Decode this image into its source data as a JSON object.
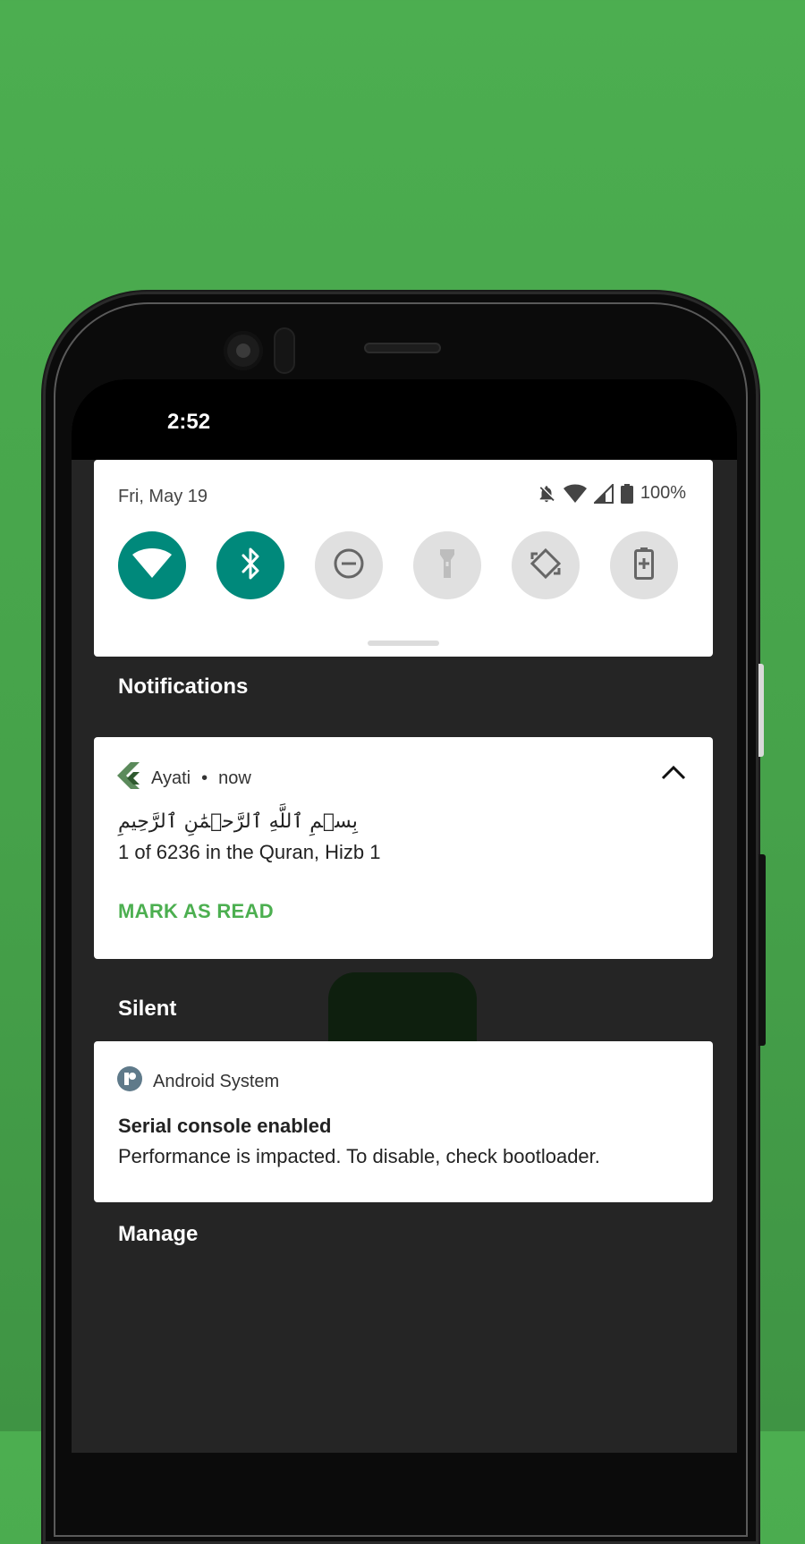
{
  "status_bar": {
    "time": "2:52"
  },
  "quick_settings": {
    "date": "Fri, May 19",
    "battery_percent": "100%",
    "tiles": [
      {
        "name": "wifi",
        "icon": "wifi-icon",
        "on": true
      },
      {
        "name": "bluetooth",
        "icon": "bluetooth-icon",
        "on": true
      },
      {
        "name": "do-not-disturb",
        "icon": "dnd-icon",
        "on": false
      },
      {
        "name": "flashlight",
        "icon": "flashlight-icon",
        "on": false
      },
      {
        "name": "auto-rotate",
        "icon": "rotate-icon",
        "on": false
      },
      {
        "name": "battery-saver",
        "icon": "battery-saver-icon",
        "on": false
      }
    ]
  },
  "notifications_header": "Notifications",
  "ayati_notification": {
    "app_name": "Ayati",
    "separator": "•",
    "time": "now",
    "arabic_text": "بِسۡمِ ٱللَّهِ ٱلرَّحۡمَٰنِ ٱلرَّحِيمِ",
    "body": "1 of 6236 in the Quran, Hizb 1",
    "action": "MARK AS READ"
  },
  "silent_header": "Silent",
  "system_notification": {
    "app_name": "Android System",
    "title": "Serial console enabled",
    "body": "Performance is impacted. To disable, check bootloader."
  },
  "manage_label": "Manage",
  "colors": {
    "background": "#4cae50",
    "tile_on": "#00897b",
    "tile_off": "#e0e0e0",
    "action": "#4caf50"
  }
}
